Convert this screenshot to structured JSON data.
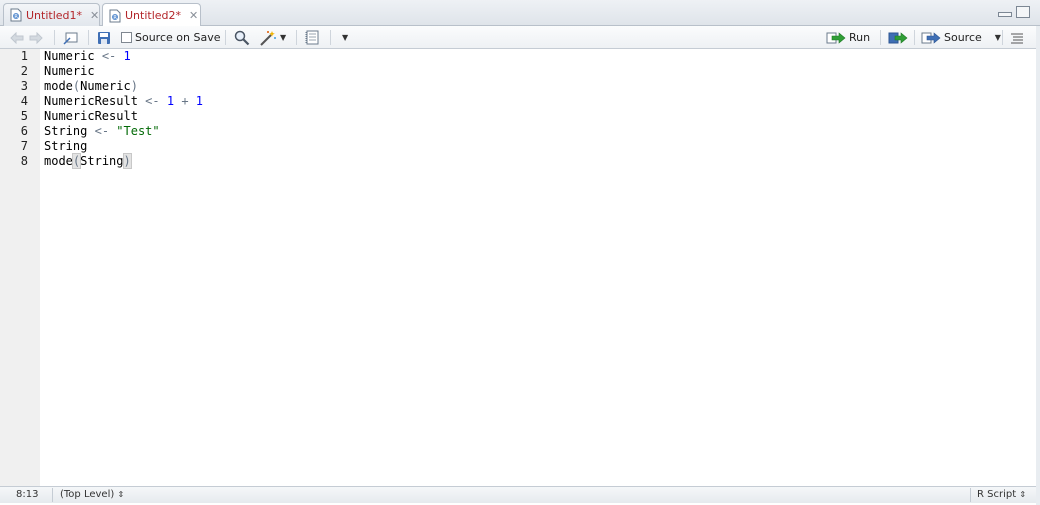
{
  "tabs": [
    {
      "label": "Untitled1*",
      "active": false
    },
    {
      "label": "Untitled2*",
      "active": true
    }
  ],
  "toolbar": {
    "source_on_save_label": "Source on Save",
    "run_label": "Run",
    "source_label": "Source"
  },
  "editor": {
    "line_numbers": [
      "1",
      "2",
      "3",
      "4",
      "5",
      "6",
      "7",
      "8"
    ],
    "lines": [
      {
        "ident": "Numeric",
        "op": "<-",
        "value": "1"
      },
      {
        "text": "Numeric"
      },
      {
        "fn": "mode",
        "open": "(",
        "arg": "Numeric",
        "close": ")"
      },
      {
        "ident": "NumericResult",
        "op": "<-",
        "a": "1",
        "plus": "+",
        "b": "1"
      },
      {
        "text": "NumericResult"
      },
      {
        "ident": "String",
        "op": "<-",
        "str": "\"Test\""
      },
      {
        "text": "String"
      },
      {
        "fn": "mode",
        "open": "(",
        "arg": "String",
        "close": ")"
      }
    ]
  },
  "status": {
    "cursor": "8:13",
    "scope": "(Top Level)",
    "filetype": "R Script"
  },
  "colors": {
    "tab_text": "#b3262a",
    "number": "#0000ff",
    "string": "#036a07",
    "operator": "#687687"
  }
}
